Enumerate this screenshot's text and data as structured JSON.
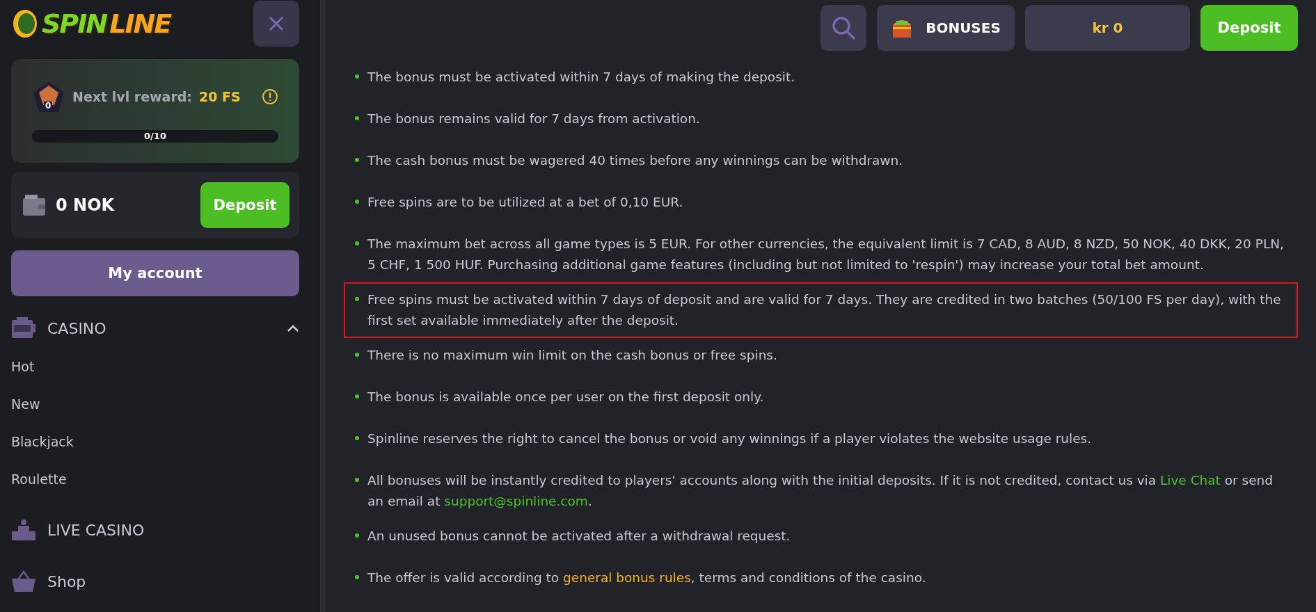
{
  "sidebar": {
    "logo": {
      "first": "SPIN",
      "second": "LINE"
    },
    "level_card": {
      "badge": "0",
      "label": "Next lvl reward:",
      "reward": "20 FS",
      "progress": "0/10"
    },
    "wallet": {
      "balance": "0 NOK",
      "deposit": "Deposit"
    },
    "account_button": "My account",
    "nav": [
      {
        "label": "CASINO",
        "kind": "slots",
        "expanded": true,
        "children": [
          {
            "label": "Hot"
          },
          {
            "label": "New"
          },
          {
            "label": "Blackjack"
          },
          {
            "label": "Roulette"
          }
        ]
      },
      {
        "label": "LIVE CASINO",
        "kind": "dealer"
      },
      {
        "label": "Shop",
        "kind": "basket"
      }
    ]
  },
  "header": {
    "bonuses": "BONUSES",
    "balance": "kr 0",
    "deposit": "Deposit"
  },
  "rules": [
    {
      "highlighted": false,
      "parts": [
        {
          "kind": "text",
          "text": "The bonus must be activated within 7 days of making the deposit."
        }
      ]
    },
    {
      "highlighted": false,
      "parts": [
        {
          "kind": "text",
          "text": "The bonus remains valid for 7 days from activation."
        }
      ]
    },
    {
      "highlighted": false,
      "parts": [
        {
          "kind": "text",
          "text": "The cash bonus must be wagered 40 times before any winnings can be withdrawn."
        }
      ]
    },
    {
      "highlighted": false,
      "parts": [
        {
          "kind": "text",
          "text": "Free spins are to be utilized at a bet of 0,10 EUR."
        }
      ]
    },
    {
      "highlighted": false,
      "parts": [
        {
          "kind": "text",
          "text": "The maximum bet across all game types is 5 EUR. For other currencies, the equivalent limit is 7 CAD, 8 AUD, 8 NZD, 50 NOK, 40 DKK, 20 PLN, 5 CHF, 1 500 HUF. Purchasing additional game features (including but not limited to 'respin') may increase your total bet amount."
        }
      ]
    },
    {
      "highlighted": true,
      "parts": [
        {
          "kind": "text",
          "text": "Free spins must be activated within 7 days of deposit and are valid for 7 days. They are credited in two batches (50/100 FS per day), with the first set available immediately after the deposit."
        }
      ]
    },
    {
      "highlighted": false,
      "parts": [
        {
          "kind": "text",
          "text": "There is no maximum win limit on the cash bonus or free spins."
        }
      ]
    },
    {
      "highlighted": false,
      "parts": [
        {
          "kind": "text",
          "text": "The bonus is available once per user on the first deposit only."
        }
      ]
    },
    {
      "highlighted": false,
      "parts": [
        {
          "kind": "text",
          "text": "Spinline reserves the right to cancel the bonus or void any winnings if a player violates the website usage rules."
        }
      ]
    },
    {
      "highlighted": false,
      "parts": [
        {
          "kind": "text",
          "text": "All bonuses will be instantly credited to players' accounts along with the initial deposits. If it is not credited, contact us via "
        },
        {
          "kind": "link",
          "text": "Live Chat",
          "color": "#4cc22a"
        },
        {
          "kind": "text",
          "text": " or send an email at "
        },
        {
          "kind": "link",
          "text": "support@spinline.com",
          "color": "#4cc22a"
        },
        {
          "kind": "text",
          "text": "."
        }
      ]
    },
    {
      "highlighted": false,
      "parts": [
        {
          "kind": "text",
          "text": "An unused bonus cannot be activated after a withdrawal request."
        }
      ]
    },
    {
      "highlighted": false,
      "parts": [
        {
          "kind": "text",
          "text": "The offer is valid according to "
        },
        {
          "kind": "link",
          "text": "general bonus rules",
          "color": "#f5b21f"
        },
        {
          "kind": "text",
          "text": ", terms and conditions of the casino."
        }
      ]
    }
  ]
}
